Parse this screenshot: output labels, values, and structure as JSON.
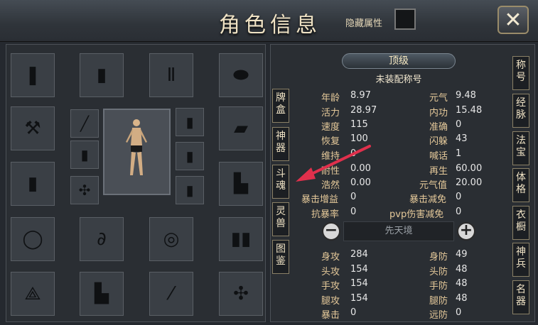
{
  "header": {
    "title": "角色信息",
    "hidden_attr_label": "隐藏属性",
    "close_icon": "close-x-icon"
  },
  "equipment": {
    "slots": [
      {
        "name": "wrist-guard-slot",
        "icon": "bracer-icon"
      },
      {
        "name": "armor-slot",
        "icon": "chest-armor-icon"
      },
      {
        "name": "pants-slot",
        "icon": "pants-icon"
      },
      {
        "name": "hat-slot",
        "icon": "hat-icon"
      },
      {
        "name": "weapon-axe-slot",
        "icon": "axe-icon"
      },
      {
        "name": "stick-slot",
        "icon": "stick-icon"
      },
      {
        "name": "robe-slot-left-1",
        "icon": "robe-icon"
      },
      {
        "name": "mace-slot",
        "icon": "mace-icon"
      },
      {
        "name": "robe-slot-right-1",
        "icon": "robe-icon"
      },
      {
        "name": "robe-slot-right-2",
        "icon": "robe-icon"
      },
      {
        "name": "robe-slot-right-3",
        "icon": "robe-icon"
      },
      {
        "name": "sash-slot",
        "icon": "sash-icon"
      },
      {
        "name": "cloak-slot",
        "icon": "cloak-icon"
      },
      {
        "name": "jacket-slot",
        "icon": "jacket-icon"
      },
      {
        "name": "necklace-slot",
        "icon": "necklace-icon"
      },
      {
        "name": "pendant-slot",
        "icon": "pendant-icon"
      },
      {
        "name": "ring-slot",
        "icon": "ring-icon"
      },
      {
        "name": "boots-slot",
        "icon": "boots-icon"
      },
      {
        "name": "mount-slot",
        "icon": "bird-icon"
      },
      {
        "name": "coat-slot",
        "icon": "coat-icon"
      },
      {
        "name": "feather-slot",
        "icon": "feather-icon"
      },
      {
        "name": "hammer-slot",
        "icon": "hammer-icon"
      }
    ]
  },
  "left_tabs": [
    {
      "label": "牌盒"
    },
    {
      "label": "神器"
    },
    {
      "label": "斗魂"
    },
    {
      "label": "灵兽"
    },
    {
      "label": "图鉴"
    }
  ],
  "right_tabs": [
    {
      "label": "称号"
    },
    {
      "label": "经脉"
    },
    {
      "label": "法宝"
    },
    {
      "label": "体格"
    },
    {
      "label": "衣橱"
    },
    {
      "label": "神兵"
    },
    {
      "label": "名器"
    }
  ],
  "rank": "顶级",
  "title_status": "未装配称号",
  "stats_left": [
    {
      "label": "年龄",
      "value": "8.97"
    },
    {
      "label": "活力",
      "value": "28.97"
    },
    {
      "label": "速度",
      "value": "115"
    },
    {
      "label": "恢复",
      "value": "100"
    },
    {
      "label": "维持",
      "value": "0"
    },
    {
      "label": "耐性",
      "value": "0.00"
    },
    {
      "label": "浩然",
      "value": "0.00"
    },
    {
      "label": "暴击增益",
      "value": "0"
    },
    {
      "label": "抗暴率",
      "value": "0"
    }
  ],
  "stats_right": [
    {
      "label": "元气",
      "value": "9.48"
    },
    {
      "label": "内功",
      "value": "15.48"
    },
    {
      "label": "准确",
      "value": "0"
    },
    {
      "label": "闪躲",
      "value": "43"
    },
    {
      "label": "喊话",
      "value": "1"
    },
    {
      "label": "再生",
      "value": "60.00"
    },
    {
      "label": "元气值",
      "value": "20.00"
    },
    {
      "label": "暴击减免",
      "value": "0"
    },
    {
      "label": "pvp伤害减免",
      "value": "0"
    }
  ],
  "realm": {
    "label": "先天境",
    "minus_icon": "minus-circle-icon",
    "plus_icon": "plus-circle-icon"
  },
  "combat_left": [
    {
      "label": "身攻",
      "value": "284"
    },
    {
      "label": "头攻",
      "value": "154"
    },
    {
      "label": "手攻",
      "value": "154"
    },
    {
      "label": "腿攻",
      "value": "154"
    },
    {
      "label": "暴击",
      "value": "0"
    }
  ],
  "combat_right": [
    {
      "label": "身防",
      "value": "49"
    },
    {
      "label": "头防",
      "value": "48"
    },
    {
      "label": "手防",
      "value": "48"
    },
    {
      "label": "腿防",
      "value": "48"
    },
    {
      "label": "远防",
      "value": "0"
    }
  ],
  "annotation": {
    "icon": "red-arrow-icon",
    "color": "#e0304c"
  }
}
